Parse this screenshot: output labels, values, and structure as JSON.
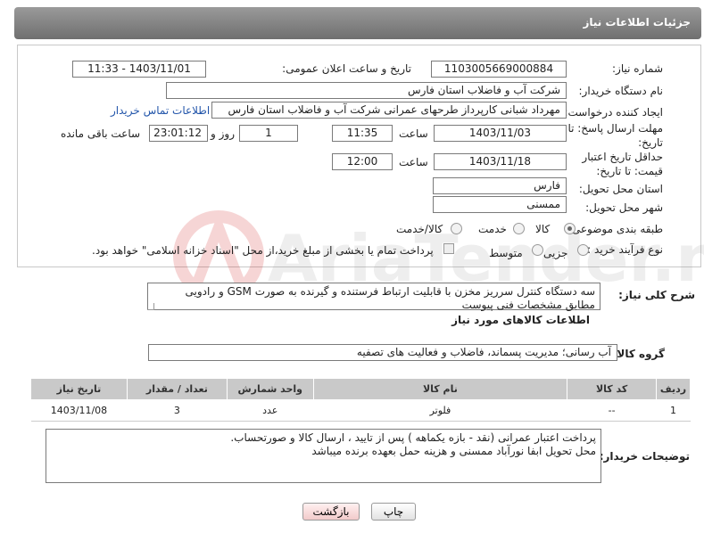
{
  "header": {
    "title": "جزئیات اطلاعات نیاز"
  },
  "labels": {
    "need_number": "شماره نیاز:",
    "announce_datetime": "تاریخ و ساعت اعلان عمومی:",
    "buyer_org": "نام دستگاه خریدار:",
    "requester": "ایجاد کننده درخواست:",
    "reply_deadline": "مهلت ارسال پاسخ: تا تاریخ:",
    "min_validity": "حداقل تاریخ اعتبار قیمت: تا تاریخ:",
    "time_word": "ساعت",
    "day_word": "روز و",
    "remaining": "ساعت باقی مانده",
    "province": "استان محل تحویل:",
    "city": "شهر محل تحویل:",
    "category": "طبقه بندی موضوعی:",
    "process": "نوع فرآیند خرید :",
    "general_desc": "شرح کلی نیاز:",
    "goods_info": "اطلاعات کالاهای مورد نیاز",
    "goods_group": "گروه کالا:",
    "buyer_notes": "توضیحات خریدار:"
  },
  "fields": {
    "need_number": "1103005669000884",
    "announce_datetime": "1403/11/01 - 11:33",
    "buyer_org": "شرکت آب و فاضلاب استان فارس",
    "requester": "مهرداد شبانی کارپرداز طرحهای عمرانی  شرکت آب و فاضلاب استان فارس",
    "contact_link": "اطلاعات تماس خریدار",
    "reply_date": "1403/11/03",
    "reply_time": "11:35",
    "reply_days": "1",
    "reply_remaining": "23:01:12",
    "validity_date": "1403/11/18",
    "validity_time": "12:00",
    "province": "فارس",
    "city": "ممسنی",
    "general_desc": "سه دستگاه کنترل سرریز مخزن با قابلیت ارتباط فرستنده و گیرنده به صورت GSM و رادویی مطابق مشخصات فنی پیوست",
    "goods_group": "آب رسانی؛ مدیریت پسماند، فاضلاب و فعالیت های تصفیه",
    "buyer_notes_line1": "پرداخت اعتبار  عمرانی  (نقد - بازه یکماهه ) پس از تایید ، ارسال کالا  و صورتحساب.",
    "buyer_notes_line2": "محل تحویل  ابفا  نورآباد ممسنی و هزینه حمل  بعهده برنده میباشد"
  },
  "category_options": [
    {
      "label": "کالا",
      "selected": true
    },
    {
      "label": "خدمت",
      "selected": false
    },
    {
      "label": "کالا/خدمت",
      "selected": false
    }
  ],
  "process_options": [
    {
      "label": "جزیی",
      "selected": true
    },
    {
      "label": "متوسط",
      "selected": false
    }
  ],
  "treasury_note": "پرداخت تمام یا بخشی از مبلغ خرید،از محل \"اسناد خزانه اسلامی\" خواهد بود.",
  "table": {
    "headers": [
      "ردیف",
      "کد کالا",
      "نام کالا",
      "واحد شمارش",
      "تعداد / مقدار",
      "تاریخ نیاز"
    ],
    "rows": [
      [
        "1",
        "--",
        "فلوتر",
        "عدد",
        "3",
        "1403/11/08"
      ]
    ]
  },
  "buttons": {
    "print": "چاپ",
    "back": "بازگشت"
  },
  "watermark": {
    "text": "AriaTender.net"
  }
}
